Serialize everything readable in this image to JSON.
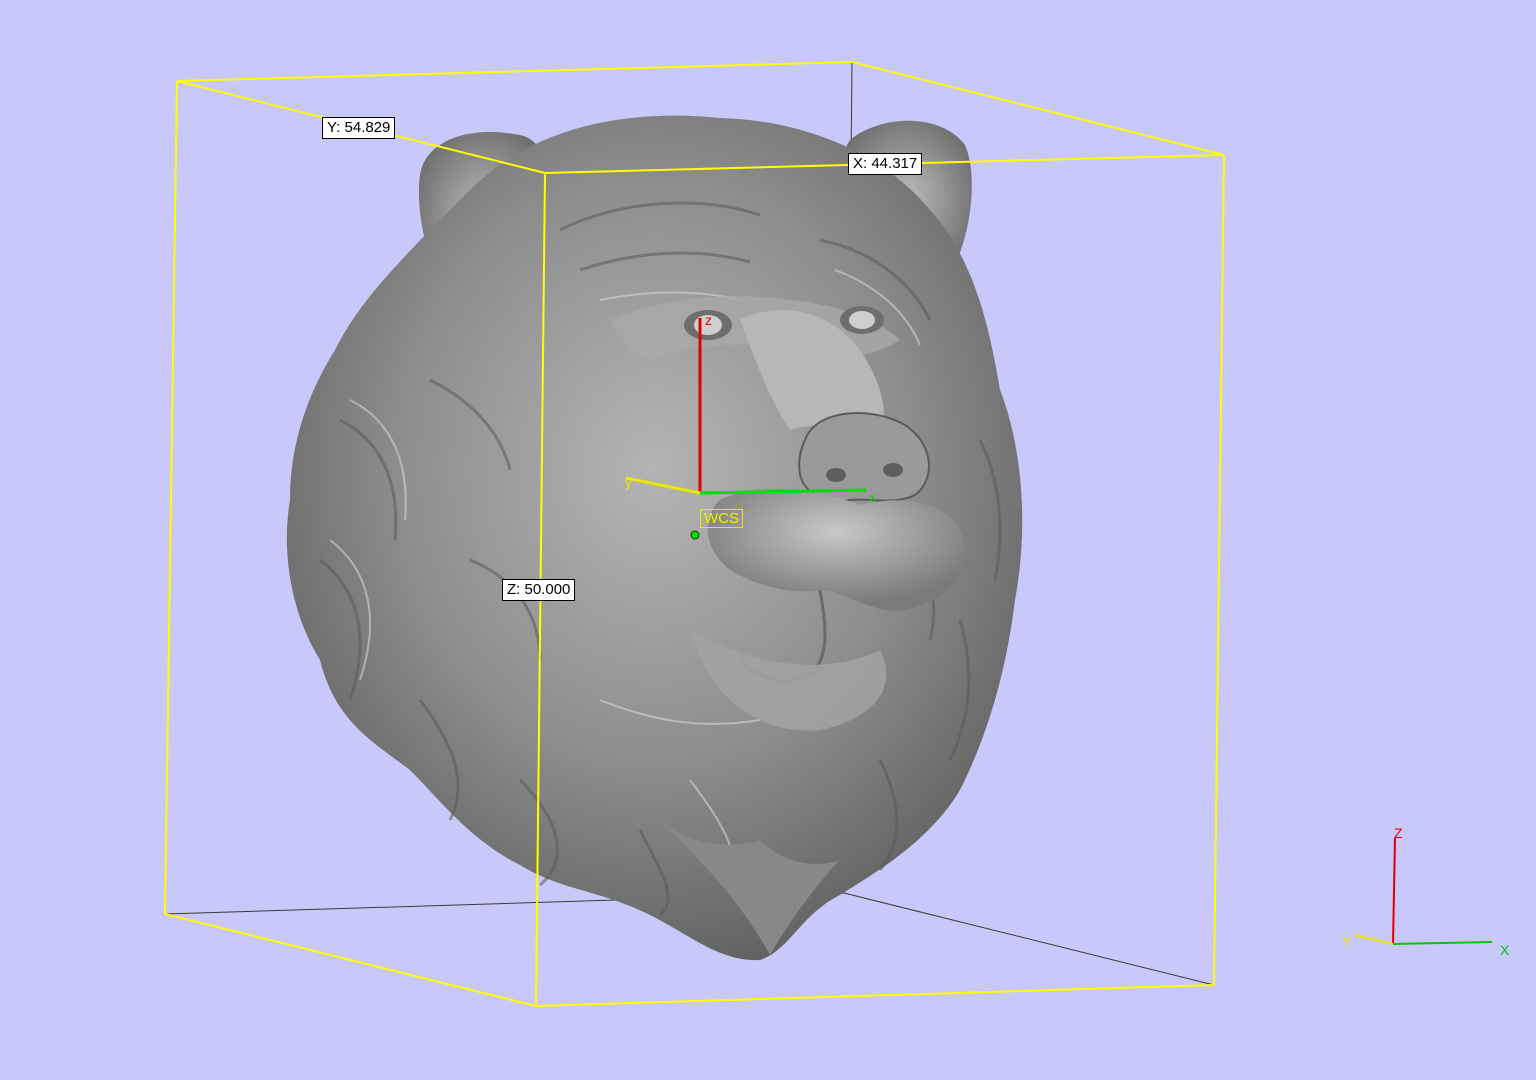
{
  "viewport": {
    "background": "#c8c8fa",
    "model_color": "#8c8c8c",
    "bbox_color": "#ffff00"
  },
  "dimensions": {
    "x_label": "X: 44.317",
    "y_label": "Y: 54.829",
    "z_label": "Z: 50.000"
  },
  "wcs": {
    "label": "WCS",
    "axis_x": "x",
    "axis_y": "y",
    "axis_z": "z"
  },
  "triad": {
    "axis_x": "X",
    "axis_y": "Y",
    "axis_z": "Z",
    "x_color": "#00c800",
    "y_color": "#e8e800",
    "z_color": "#e00000"
  }
}
